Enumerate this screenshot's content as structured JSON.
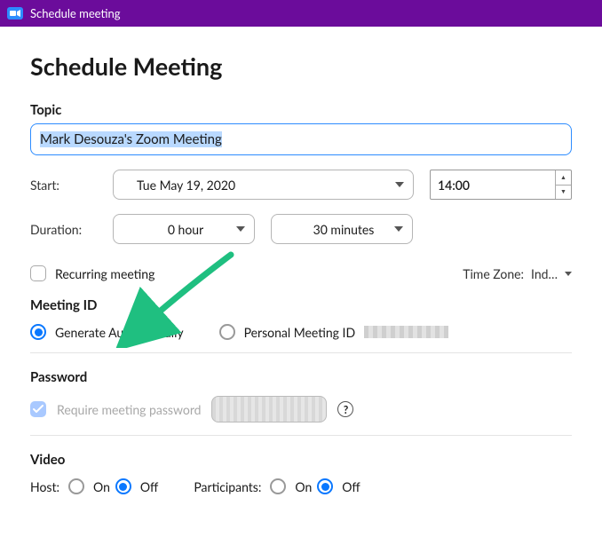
{
  "titlebar": {
    "title": "Schedule meeting"
  },
  "page": {
    "heading": "Schedule Meeting"
  },
  "topic": {
    "label": "Topic",
    "value": "Mark Desouza's Zoom Meeting"
  },
  "start": {
    "label": "Start:",
    "date": "Tue  May 19, 2020",
    "time": "14:00"
  },
  "duration": {
    "label": "Duration:",
    "hours": "0 hour",
    "minutes": "30 minutes"
  },
  "recurring": {
    "label": "Recurring meeting",
    "checked": false
  },
  "timezone": {
    "prefix": "Time Zone:",
    "value": "Ind…"
  },
  "meeting_id": {
    "title": "Meeting ID",
    "generate_label": "Generate Automatically",
    "personal_label": "Personal Meeting ID",
    "selected": "generate"
  },
  "password": {
    "title": "Password",
    "require_label": "Require meeting password",
    "checked": true
  },
  "video": {
    "title": "Video",
    "host_label": "Host:",
    "participants_label": "Participants:",
    "on_label": "On",
    "off_label": "Off",
    "host_value": "off",
    "participants_value": "off"
  }
}
